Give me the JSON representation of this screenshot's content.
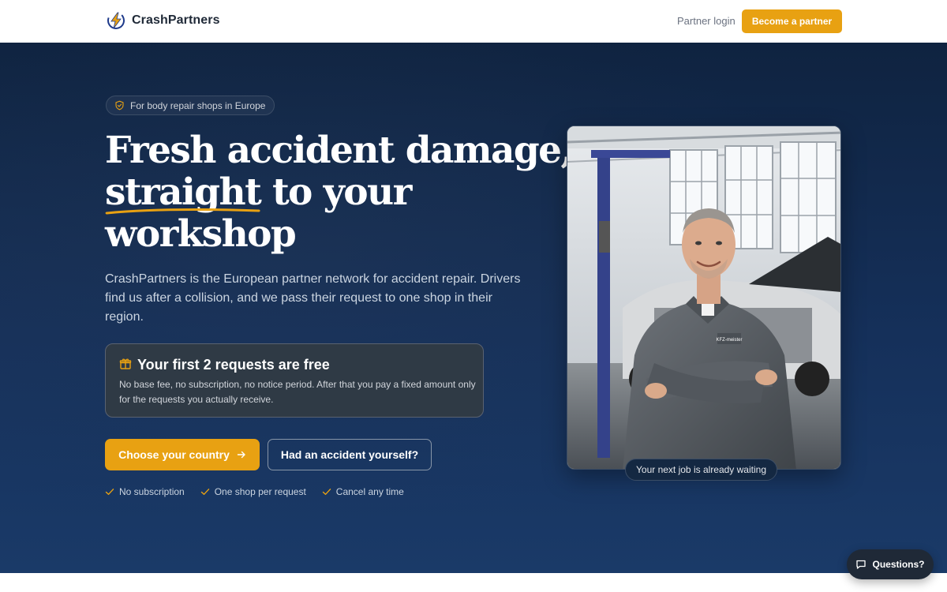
{
  "header": {
    "brand": "CrashPartners",
    "login_label": "Partner login",
    "cta_label": "Become a partner"
  },
  "hero": {
    "badge": "For body repair shops in Europe",
    "headline": {
      "line1": "Fresh accident damage,",
      "line2_highlight": "straight",
      "line2_rest": " to your",
      "line3": "workshop"
    },
    "lead": "CrashPartners is the European partner network for accident repair. Drivers find us after a collision, and we pass their request to one shop in their region.",
    "offer": {
      "title": "Your first 2 requests are free",
      "text": "No base fee, no subscription, no notice period. After that you pay a fixed amount only for the requests you actually receive."
    },
    "primary_cta": "Choose your country",
    "secondary_cta": "Had an accident yourself?",
    "checks": [
      "No subscription",
      "One shop per request",
      "Cancel any time"
    ],
    "photo_caption": "Your next job is already waiting",
    "photo_badge": "KFZ-meister"
  },
  "chat": {
    "label": "Questions?"
  },
  "colors": {
    "accent": "#e8a112",
    "hero_bg": "#15305a",
    "chat_bg": "#1f2937"
  },
  "icons": {
    "brand": "bolt-logo-icon",
    "badge": "shield-check-icon",
    "offer": "gift-icon",
    "primary_cta": "arrow-right-icon",
    "checks": "check-icon",
    "chat": "chat-bubble-icon"
  }
}
